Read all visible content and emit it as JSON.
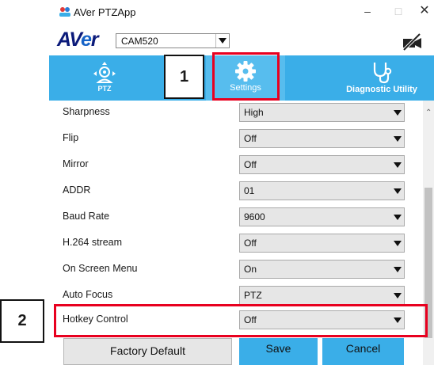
{
  "window": {
    "title": "AVer PTZApp",
    "controls": {
      "minimize": "–",
      "maximize": "□",
      "close": "✕"
    }
  },
  "brand": {
    "logo_a": "AV",
    "logo_e": "e",
    "logo_r": "r"
  },
  "camera_select": {
    "value": "CAM520"
  },
  "toolbar": {
    "ptz_label": "PTZ",
    "settings_label": "Settings",
    "diagnostic_label": "Diagnostic Utility"
  },
  "settings": [
    {
      "label": "Sharpness",
      "value": "High"
    },
    {
      "label": "Flip",
      "value": "Off"
    },
    {
      "label": "Mirror",
      "value": "Off"
    },
    {
      "label": "ADDR",
      "value": "01"
    },
    {
      "label": "Baud Rate",
      "value": "9600"
    },
    {
      "label": "H.264 stream",
      "value": "Off"
    },
    {
      "label": "On Screen Menu",
      "value": "On"
    },
    {
      "label": "Auto Focus",
      "value": "PTZ"
    },
    {
      "label": "Hotkey Control",
      "value": "Off"
    }
  ],
  "buttons": {
    "factory_default": "Factory Default",
    "save": "Save",
    "cancel": "Cancel"
  },
  "callouts": {
    "step1": "1",
    "step2": "2"
  },
  "colors": {
    "toolbar": "#3aaee8",
    "highlight": "#e8001f",
    "logo": "#0b1a7a"
  }
}
